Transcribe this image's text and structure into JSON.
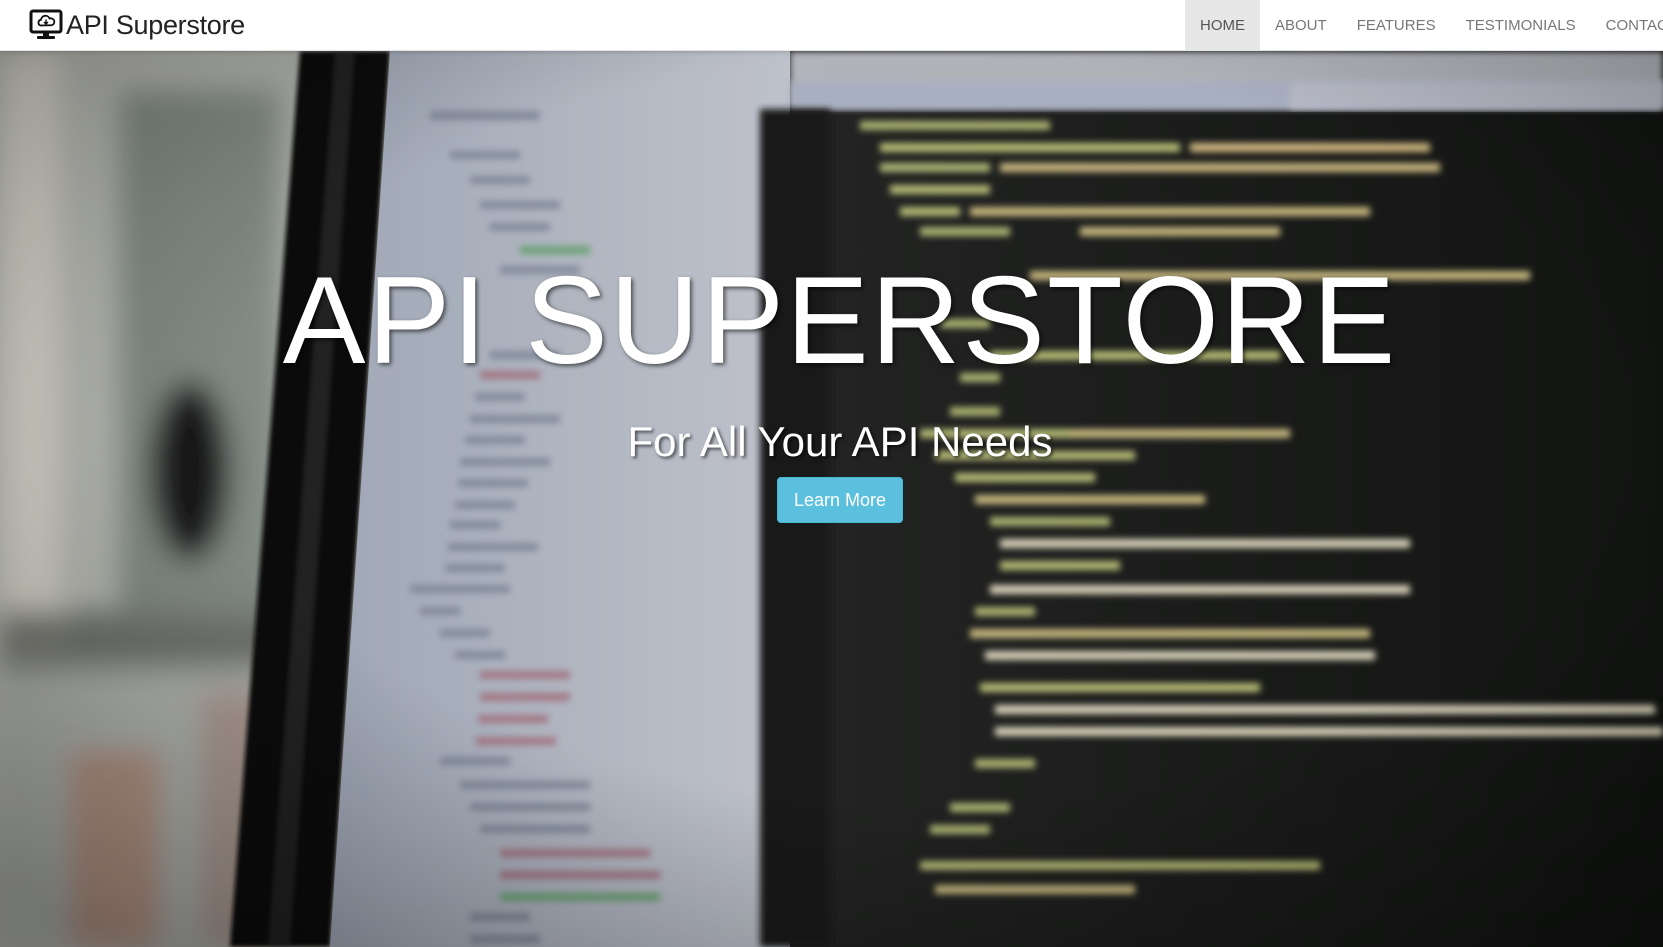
{
  "navbar": {
    "brand_text": "API Superstore",
    "brand_icon": "monitor-cloud-icon",
    "links": [
      {
        "label": "Home",
        "active": true
      },
      {
        "label": "About",
        "active": false
      },
      {
        "label": "Features",
        "active": false
      },
      {
        "label": "Testimonials",
        "active": false
      },
      {
        "label": "Contact Us",
        "active": false
      }
    ]
  },
  "hero": {
    "title": "API SUPERSTORE",
    "subtitle": "For All Your API Needs",
    "button_label": "Learn More",
    "background": "blurred-code-on-monitor"
  },
  "colors": {
    "button": "#5bc0de",
    "nav_active_bg": "#e7e7e7",
    "nav_text": "#777777",
    "navbar_bg": "#ffffff"
  }
}
